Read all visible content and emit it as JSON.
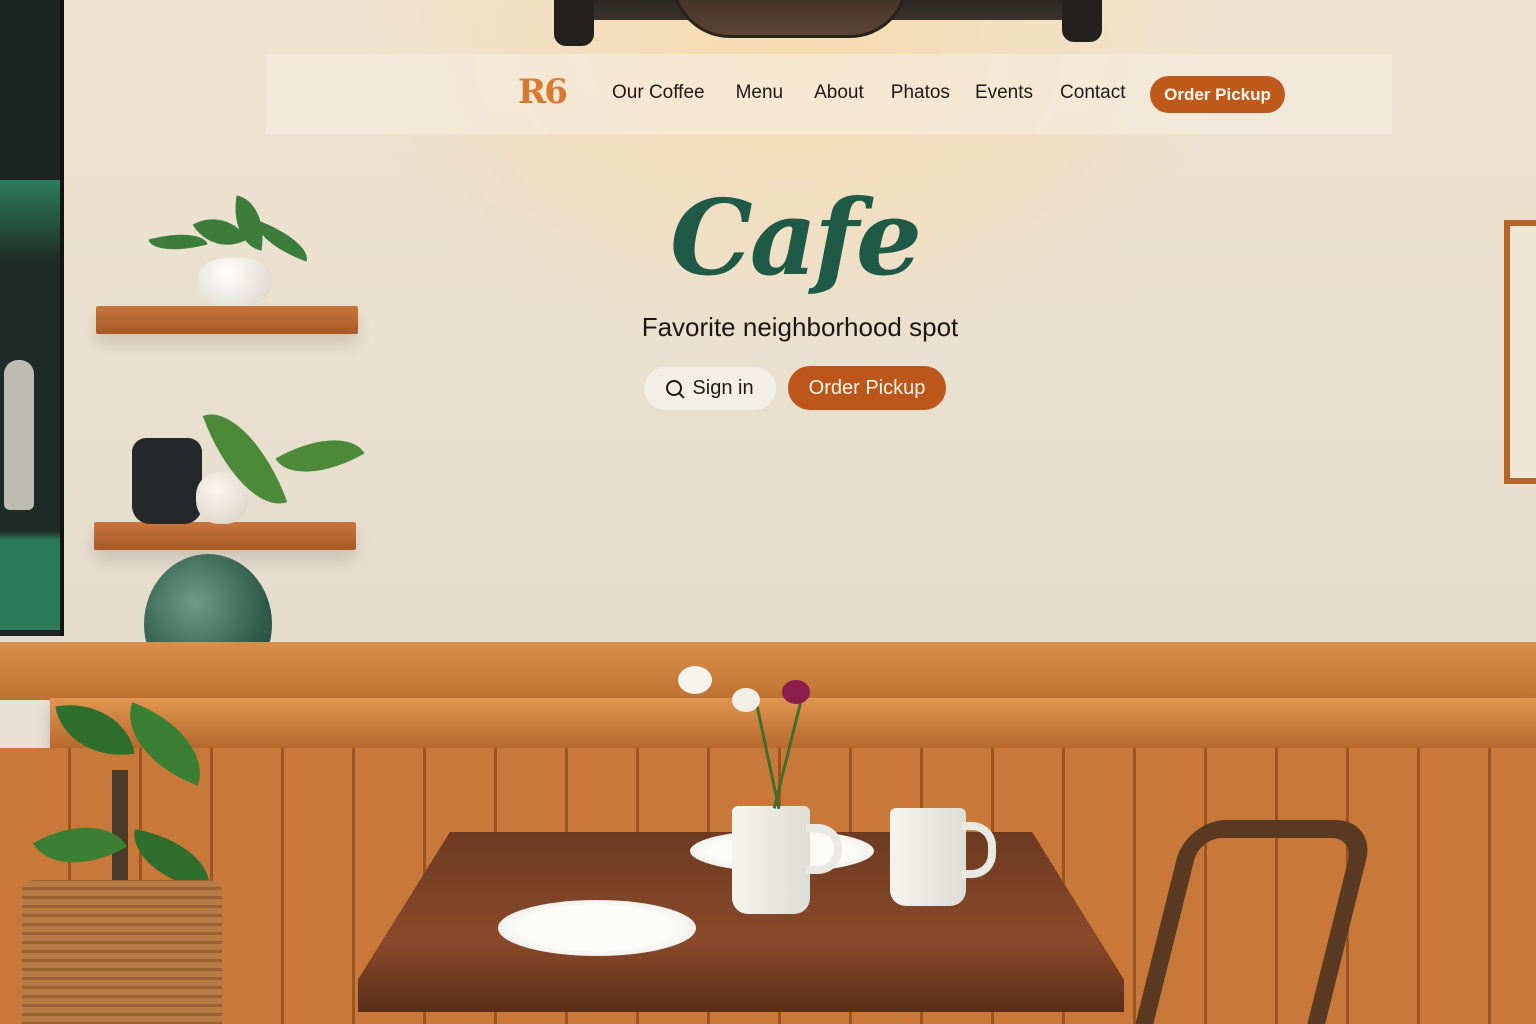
{
  "brand": {
    "logo_text": "R6"
  },
  "nav": {
    "links": [
      {
        "label": "Our Coffee"
      },
      {
        "label": "Menu"
      },
      {
        "label": "About"
      },
      {
        "label": "Phatos"
      },
      {
        "label": "Events"
      },
      {
        "label": "Contact"
      }
    ],
    "cta_label": "Order Pickup"
  },
  "hero": {
    "title": "Cafe",
    "subtitle": "Favorite neighborhood spot",
    "signin_label": "Sign in",
    "signin_icon": "search-icon",
    "order_label": "Order Pickup"
  },
  "colors": {
    "accent_orange": "#c05a1c",
    "brand_orange": "#d97a32",
    "title_green": "#1f5a47",
    "wall_cream": "#ece2d0",
    "wood": "#c8793a"
  }
}
